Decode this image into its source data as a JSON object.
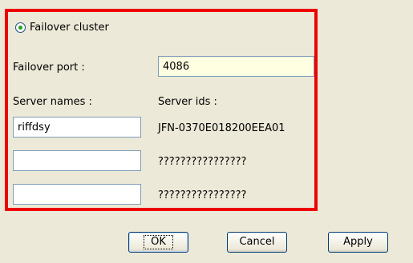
{
  "failover": {
    "radio_label": "Failover cluster",
    "port_label": "Failover port :",
    "port_value": "4086",
    "server_names_label": "Server names :",
    "server_ids_label": "Server ids :",
    "servers": [
      {
        "name": "riffdsy",
        "id": "JFN-0370E018200EEA01"
      },
      {
        "name": "",
        "id": "????????????????"
      },
      {
        "name": "",
        "id": "????????????????"
      }
    ]
  },
  "buttons": {
    "ok": "OK",
    "cancel": "Cancel",
    "apply": "Apply"
  },
  "colors": {
    "highlight_border": "#ee0000",
    "dialog_background": "#ece9d8",
    "port_field_background": "#ffffe1"
  }
}
